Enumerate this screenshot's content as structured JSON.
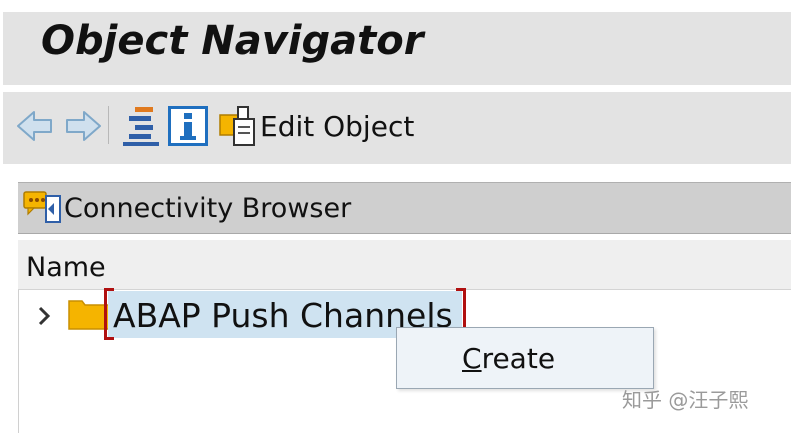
{
  "window": {
    "title": "Object Navigator"
  },
  "toolbar": {
    "back": {
      "icon": "arrow-left-icon",
      "color": "#7fa8c9"
    },
    "forward": {
      "icon": "arrow-right-icon",
      "color": "#7fa8c9"
    },
    "hierarchy": {
      "icon": "hierarchy-icon",
      "color": "#2f5fa8"
    },
    "info": {
      "icon": "info-icon",
      "color": "#1f6fbf"
    },
    "edit_object": {
      "icon": "edit-object-icon",
      "label": "Edit Object"
    }
  },
  "browser": {
    "icon": "connectivity-browser-icon",
    "title": "Connectivity Browser"
  },
  "tree": {
    "column_header": "Name",
    "nodes": [
      {
        "label": "ABAP Push Channels",
        "icon": "folder-icon",
        "expand_icon": "chevron-right-icon",
        "selected": true
      }
    ]
  },
  "context_menu": {
    "items": [
      {
        "mnemonic": "C",
        "rest": "reate"
      }
    ]
  },
  "watermark": "知乎 @汪子熙",
  "colors": {
    "panel_bg": "#e3e3e3",
    "header_bg": "#cfcfcf",
    "selection": "#cfe3f1",
    "focus": "#b01010",
    "folder": "#f5b400"
  }
}
